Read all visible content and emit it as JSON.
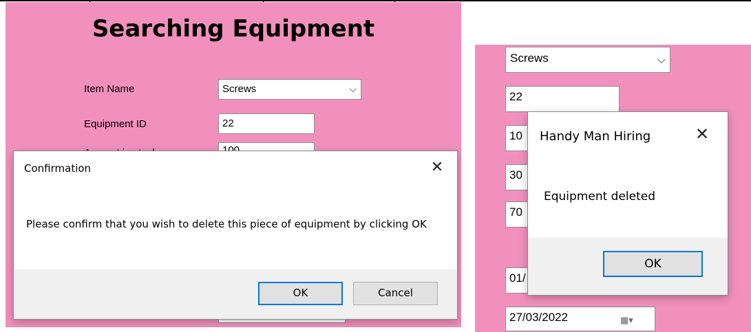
{
  "left_form": {
    "title": "Searching Equipment",
    "item_name_label": "Item Name",
    "item_name_value": "Screws",
    "equipment_id_label": "Equipment ID",
    "equipment_id_value": "22",
    "amount_label_partial": "Amount in stock",
    "amount_value_partial": "100"
  },
  "confirm_dialog": {
    "title": "Confirmation",
    "message": "Please confirm that you wish to delete this piece of equipment by clicking OK",
    "ok_label": "OK",
    "cancel_label": "Cancel"
  },
  "right_form": {
    "item_name_value": "Screws",
    "equipment_id_value": "22",
    "field3_partial": "10",
    "field4_partial": "30",
    "field5_partial": "70",
    "field6_partial": "01/",
    "date_value": "27/03/2022"
  },
  "info_dialog": {
    "title": "Handy Man Hiring",
    "message": "Equipment deleted",
    "ok_label": "OK"
  },
  "icons": {
    "chevron": "chevron-down-icon",
    "close": "close-icon",
    "calendar": "calendar-icon"
  }
}
